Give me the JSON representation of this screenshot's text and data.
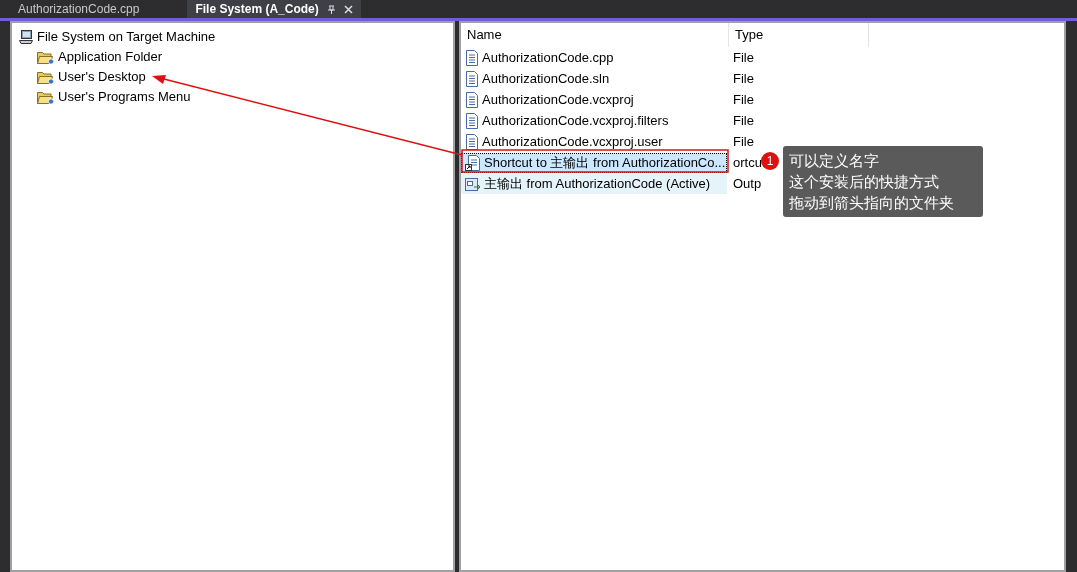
{
  "tabs": [
    {
      "label": "AuthorizationCode.cpp",
      "selected": false
    },
    {
      "label": "File System (A_Code)",
      "selected": true
    }
  ],
  "tree": [
    {
      "label": "File System on Target Machine",
      "kind": "computer",
      "children": [
        {
          "label": "Application Folder",
          "kind": "folder"
        },
        {
          "label": "User's Desktop",
          "kind": "folder"
        },
        {
          "label": "User's Programs Menu",
          "kind": "folder"
        }
      ]
    }
  ],
  "table": {
    "columns": [
      "Name",
      "Type"
    ],
    "rows": [
      {
        "kind": "file",
        "name": "AuthorizationCode.cpp",
        "type": "File",
        "selected": false,
        "focused": false
      },
      {
        "kind": "file",
        "name": "AuthorizationCode.sln",
        "type": "File",
        "selected": false,
        "focused": false
      },
      {
        "kind": "file",
        "name": "AuthorizationCode.vcxproj",
        "type": "File",
        "selected": false,
        "focused": false
      },
      {
        "kind": "file",
        "name": "AuthorizationCode.vcxproj.filters",
        "type": "File",
        "selected": false,
        "focused": false
      },
      {
        "kind": "file",
        "name": "AuthorizationCode.vcxproj.user",
        "type": "File",
        "selected": false,
        "focused": false
      },
      {
        "kind": "shortcut",
        "name": "Shortcut to 主输出 from AuthorizationCo...",
        "type": "ortcu",
        "selected": true,
        "focused": true
      },
      {
        "kind": "output",
        "name": "主输出 from AuthorizationCode (Active)",
        "type": "Outp",
        "selected": true,
        "focused": false
      }
    ]
  },
  "annotation": {
    "badge": "1",
    "note_lines": [
      "可以定义名字",
      "这个安装后的快捷方式",
      "拖动到箭头指向的文件夹"
    ]
  }
}
